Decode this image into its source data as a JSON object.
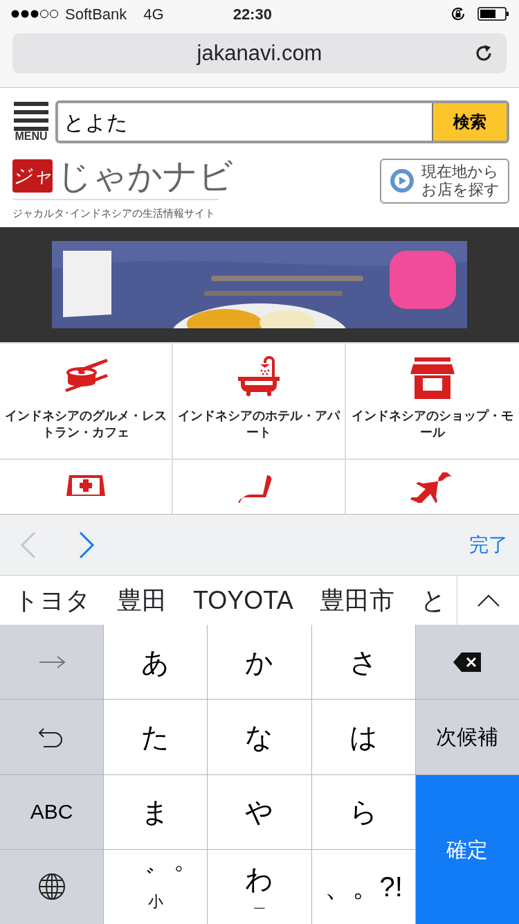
{
  "status_bar": {
    "carrier": "SoftBank",
    "network": "4G",
    "time": "22:30"
  },
  "browser": {
    "url": "jakanavi.com"
  },
  "header": {
    "menu_label": "MENU",
    "search": {
      "value": "とよた",
      "button": "検索"
    },
    "logo": {
      "mark": "ジャ",
      "name": "じゃかナビ",
      "tagline": "ジャカルタ･インドネシアの生活情報サイト"
    },
    "location_button": {
      "label_lines": [
        "現在地から",
        "お店を探す"
      ]
    }
  },
  "banner": {
    "kind": "picture"
  },
  "categories": [
    {
      "kind": "full",
      "label": "インドネシアのグルメ・レストラン・カフェ"
    },
    {
      "kind": "full",
      "label": "インドネシアのホテル・アパート"
    },
    {
      "kind": "full",
      "label": "インドネシアのショップ・モール"
    },
    {
      "kind": "cut_off"
    },
    {
      "kind": "cut_off"
    },
    {
      "kind": "cut_off"
    }
  ],
  "keyboard_toolbar": {
    "prev_disabled": true,
    "next_disabled": false,
    "done": "完了"
  },
  "candidates": [
    "トヨタ",
    "豊田",
    "TOYOTA",
    "豊田市",
    "と"
  ],
  "keyboard": {
    "keys": [
      {
        "kind": "next_arrow"
      },
      {
        "kind": "char",
        "label": "あ"
      },
      {
        "kind": "char",
        "label": "か"
      },
      {
        "kind": "char",
        "label": "さ"
      },
      {
        "kind": "delete"
      },
      {
        "kind": "undo"
      },
      {
        "kind": "char",
        "label": "た"
      },
      {
        "kind": "char",
        "label": "な"
      },
      {
        "kind": "char",
        "label": "は"
      },
      {
        "kind": "action",
        "label": "次候補"
      },
      {
        "kind": "action",
        "label": "ABC"
      },
      {
        "kind": "char",
        "label": "ま"
      },
      {
        "kind": "char",
        "label": "や"
      },
      {
        "kind": "char",
        "label": "ら"
      },
      {
        "kind": "confirm",
        "label": "確定"
      },
      {
        "kind": "globe"
      },
      {
        "kind": "stacked",
        "label": "゛゜",
        "sub": "小"
      },
      {
        "kind": "stacked",
        "label": "わ",
        "sub": "＿"
      },
      {
        "kind": "char",
        "label": "、。?!"
      }
    ]
  }
}
